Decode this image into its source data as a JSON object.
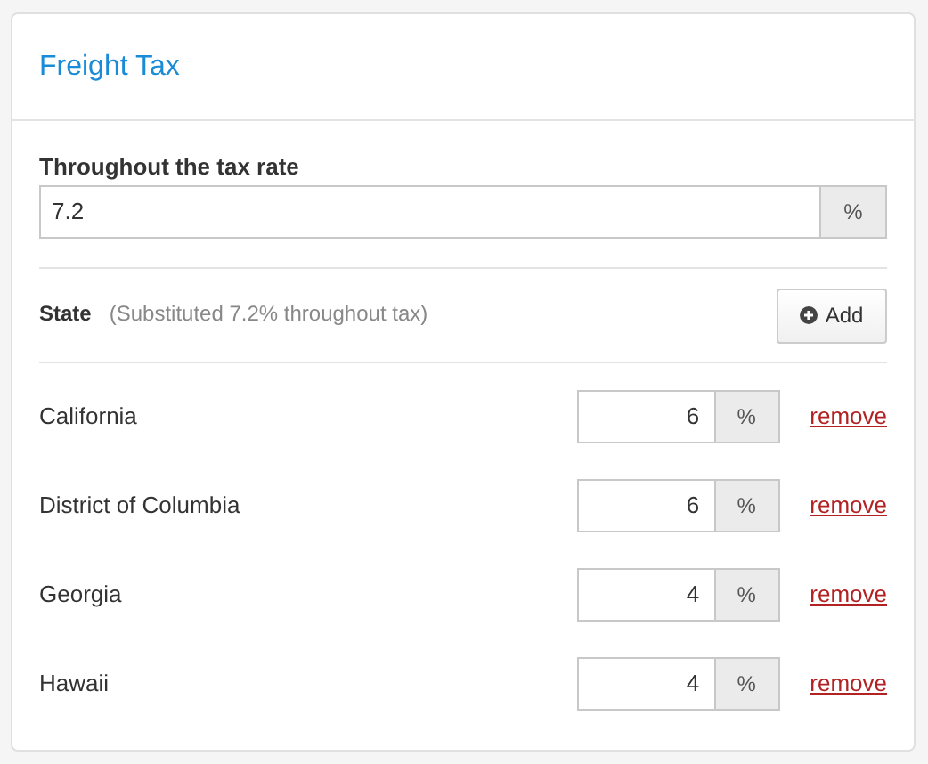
{
  "card": {
    "title": "Freight Tax"
  },
  "global_rate": {
    "label": "Throughout the tax rate",
    "value": "7.2",
    "unit": "%"
  },
  "states_header": {
    "label": "State",
    "note": "(Substituted 7.2% throughout tax)",
    "add_button": "Add"
  },
  "states": [
    {
      "name": "California",
      "value": "6",
      "unit": "%",
      "action": "remove"
    },
    {
      "name": "District of Columbia",
      "value": "6",
      "unit": "%",
      "action": "remove"
    },
    {
      "name": "Georgia",
      "value": "4",
      "unit": "%",
      "action": "remove"
    },
    {
      "name": "Hawaii",
      "value": "4",
      "unit": "%",
      "action": "remove"
    }
  ]
}
